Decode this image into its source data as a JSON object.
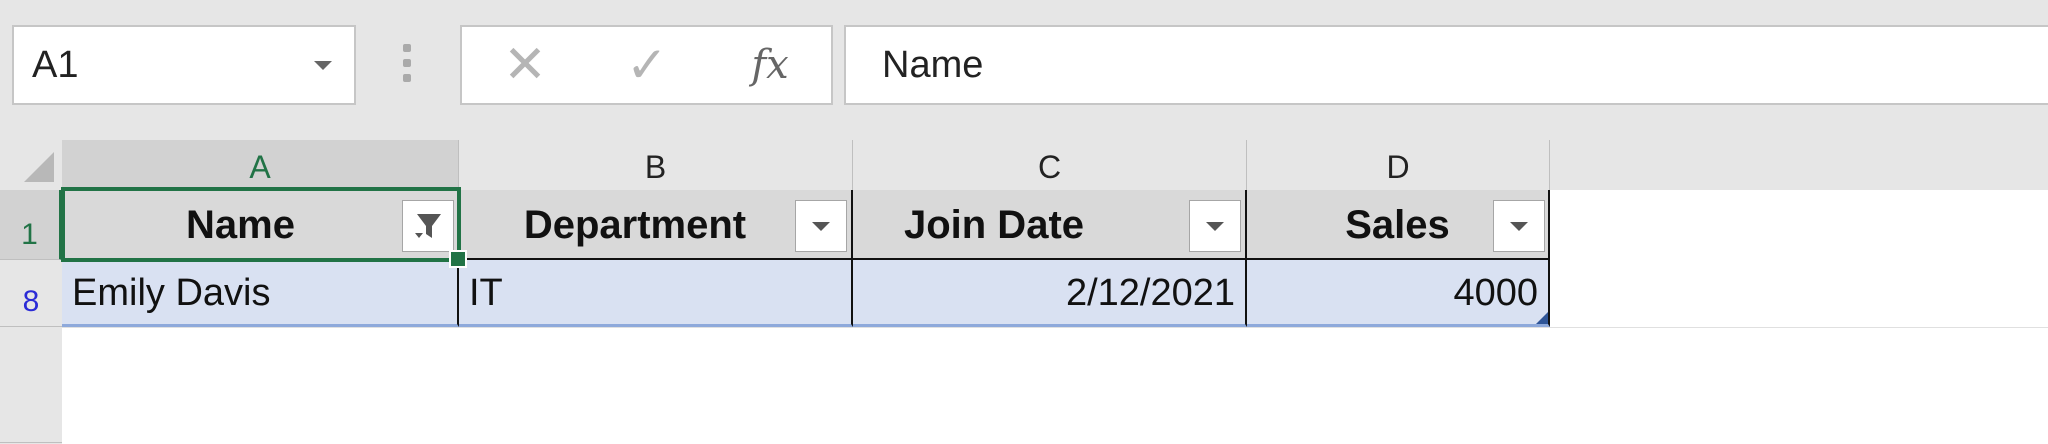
{
  "formula_bar": {
    "name_box": "A1",
    "cancel_glyph": "✕",
    "enter_glyph": "✓",
    "fx_label": "fx",
    "formula_value": "Name"
  },
  "columns": [
    {
      "letter": "A"
    },
    {
      "letter": "B"
    },
    {
      "letter": "C"
    },
    {
      "letter": "D"
    }
  ],
  "rows": {
    "header_row_number": "1",
    "data_row_number": "8"
  },
  "headers": [
    "Name",
    "Department",
    "Join Date",
    "Sales"
  ],
  "record": {
    "name": "Emily Davis",
    "department": "IT",
    "join_date": "2/12/2021",
    "sales": "4000"
  },
  "colors": {
    "accent": "#217346",
    "table_header_bg": "#d9d9d9",
    "table_row_bg": "#d9e1f2",
    "filtered_row_number": "#2b2bd6"
  }
}
